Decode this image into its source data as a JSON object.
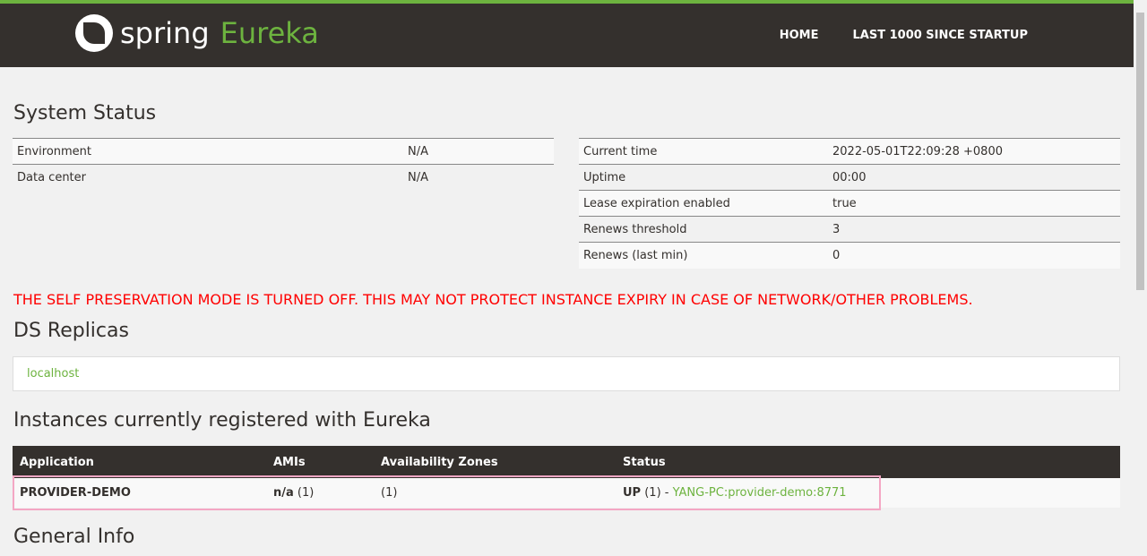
{
  "nav": {
    "brand_spring": "spring",
    "brand_eureka": "Eureka",
    "links": [
      "HOME",
      "LAST 1000 SINCE STARTUP"
    ]
  },
  "system_status": {
    "title": "System Status",
    "left": [
      {
        "k": "Environment",
        "v": "N/A"
      },
      {
        "k": "Data center",
        "v": "N/A"
      }
    ],
    "right": [
      {
        "k": "Current time",
        "v": "2022-05-01T22:09:28 +0800"
      },
      {
        "k": "Uptime",
        "v": "00:00"
      },
      {
        "k": "Lease expiration enabled",
        "v": "true"
      },
      {
        "k": "Renews threshold",
        "v": "3"
      },
      {
        "k": "Renews (last min)",
        "v": "0"
      }
    ]
  },
  "warning": "THE SELF PRESERVATION MODE IS TURNED OFF. THIS MAY NOT PROTECT INSTANCE EXPIRY IN CASE OF NETWORK/OTHER PROBLEMS.",
  "replicas": {
    "title": "DS Replicas",
    "items": [
      "localhost"
    ]
  },
  "instances": {
    "title": "Instances currently registered with Eureka",
    "headers": [
      "Application",
      "AMIs",
      "Availability Zones",
      "Status"
    ],
    "rows": [
      {
        "app": "PROVIDER-DEMO",
        "amis_bold": "n/a",
        "amis_count": " (1)",
        "zones": "(1)",
        "status_bold": "UP",
        "status_rest": " (1) - ",
        "instance_link": "YANG-PC:provider-demo:8771"
      }
    ]
  },
  "general_info": {
    "title": "General Info"
  }
}
